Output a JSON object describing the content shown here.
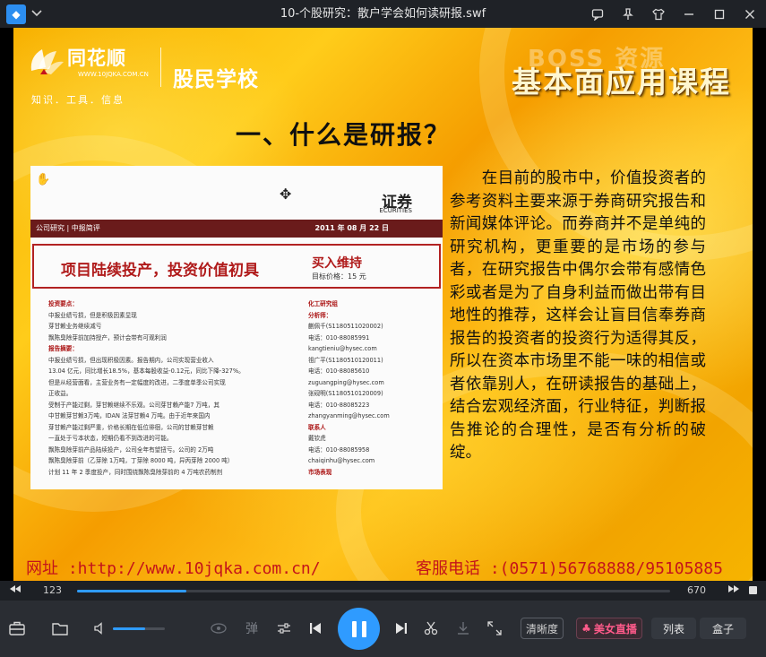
{
  "window": {
    "title": "10-个股研究：散户学会如何读研报.swf",
    "logo_glyph": "◆",
    "menu_icon": "chevron-down-icon",
    "controls": [
      "feedback-icon",
      "pin-icon",
      "skin-icon",
      "minimize-icon",
      "maximize-icon",
      "close-icon"
    ]
  },
  "slide": {
    "brand_name": "同花顺",
    "brand_url": "WWW.10JQKA.COM.CN",
    "brand_tagline": "知识．工具．信息",
    "school": "股民学校",
    "watermark": "BOSS 资源",
    "course_title": "基本面应用课程",
    "heading": "一、什么是研报？",
    "body": "　　在目前的股市中，价值投资者的参考资料主要来源于券商研究报告和新闻媒体评论。而券商并不是单纯的研究机构，更重要的是市场的参与者，在研究报告中偶尔会带有感情色彩或者是为了自身利益而做出带有目地性的推荐，这样会让盲目信奉券商报告的投资者的投资行为适得其反，所以在资本市场里不能一味的相信或者依靠别人，在研读报告的基础上，结合宏观经济面，行业特征，判断报告推论的合理性，是否有分析的破绽。",
    "website": "网址 :http://www.10jqka.com.cn/",
    "hotline": "客服电话 :(0571)56768888/95105885",
    "report": {
      "broker": "证券",
      "broker_en": "ECURITIES",
      "bar_left": "公司研究 | 中报简评",
      "bar_right": "2011 年 08 月 22 日",
      "headline": "项目陆续投产，投资价值初具",
      "rating": "买入维持",
      "target": "目标价格：15 元",
      "left_col": [
        {
          "h": true,
          "t": "投资要点："
        },
        {
          "h": false,
          "t": "中报业绩亏损，但是积极因素显现"
        },
        {
          "h": false,
          "t": "芽甘赖业务继续减亏"
        },
        {
          "h": false,
          "t": "飘陈臭除芽前加持授产，预计会带有可观利润"
        },
        {
          "h": true,
          "t": "报告摘要："
        },
        {
          "h": false,
          "t": "中报业绩亏损，但出现积极因素。报告期内，公司实现营业收入"
        },
        {
          "h": false,
          "t": "13.04 亿元，同比增长18.5%，基本每股收益-0.12元，同比下降-327%。"
        },
        {
          "h": false,
          "t": "但是从经营面看，主营业务有一定幅度的改进，二季度单季公司实现"
        },
        {
          "h": false,
          "t": "正收益。"
        },
        {
          "h": false,
          "t": "受制于产能过剩，芽甘赖继续不乐观。公司芽甘赖产能7 万吨，其"
        },
        {
          "h": false,
          "t": "中甘赖芽甘赖3万吨，IDAN 法芽甘赖4 万吨。由于近年来国内"
        },
        {
          "h": false,
          "t": "芽甘赖产能过剩严重，价格长期在低位徘徊，公司的甘赖芽甘赖"
        },
        {
          "h": false,
          "t": "一直处于亏本状态，短期仍看不到改进的可能。"
        },
        {
          "h": false,
          "t": "飘陈臭除芽前产品陆续投产，公司全年有望扭亏。公司的 2万吨"
        },
        {
          "h": false,
          "t": "飘陈臭除芽前（乙芽除 1万吨，丁芽除 8000 吨，异丙芽除 2000 吨）"
        },
        {
          "h": false,
          "t": "计划 11 年 2 季度投产，同时围绕飘陈臭除芽前的 4 万吨农药制剂"
        }
      ],
      "right_col": [
        {
          "h": true,
          "t": "化工研究组"
        },
        {
          "h": true,
          "t": "分析师："
        },
        {
          "h": false,
          "t": "蒯佩千(S1180511020002)"
        },
        {
          "h": false,
          "t": "电话：010-88085991"
        },
        {
          "h": false,
          "t": "kangtieniu@hysec.com"
        },
        {
          "h": false,
          "t": "祖广平(S1180510120011)"
        },
        {
          "h": false,
          "t": "电话：010-88085610"
        },
        {
          "h": false,
          "t": "zuguangping@hysec.com"
        },
        {
          "h": false,
          "t": "张砚明(S1180510120009)"
        },
        {
          "h": false,
          "t": "电话：010-88085223"
        },
        {
          "h": false,
          "t": "zhangyanming@hysec.com"
        },
        {
          "h": true,
          "t": "联系人"
        },
        {
          "h": false,
          "t": "戴钦虎"
        },
        {
          "h": false,
          "t": "电话：010-88085958"
        },
        {
          "h": false,
          "t": "chaiqinhu@hysec.com"
        },
        {
          "h": true,
          "t": "市场表现"
        }
      ]
    }
  },
  "timeline": {
    "prev_icon": "rewind-icon",
    "current": "123",
    "total": "670",
    "progress": 0.184,
    "next_icon": "fast-forward-icon"
  },
  "controls": {
    "volume_level": 0.62,
    "danmaku_label": "弹",
    "quality_label": "清晰度",
    "live_label": "美女直播",
    "list_label": "列表",
    "box_label": "盒子"
  },
  "colors": {
    "accent": "#2f9bff",
    "chrome": "#1f2227",
    "slide_red": "#c4141b",
    "report_red": "#b01b1b"
  }
}
